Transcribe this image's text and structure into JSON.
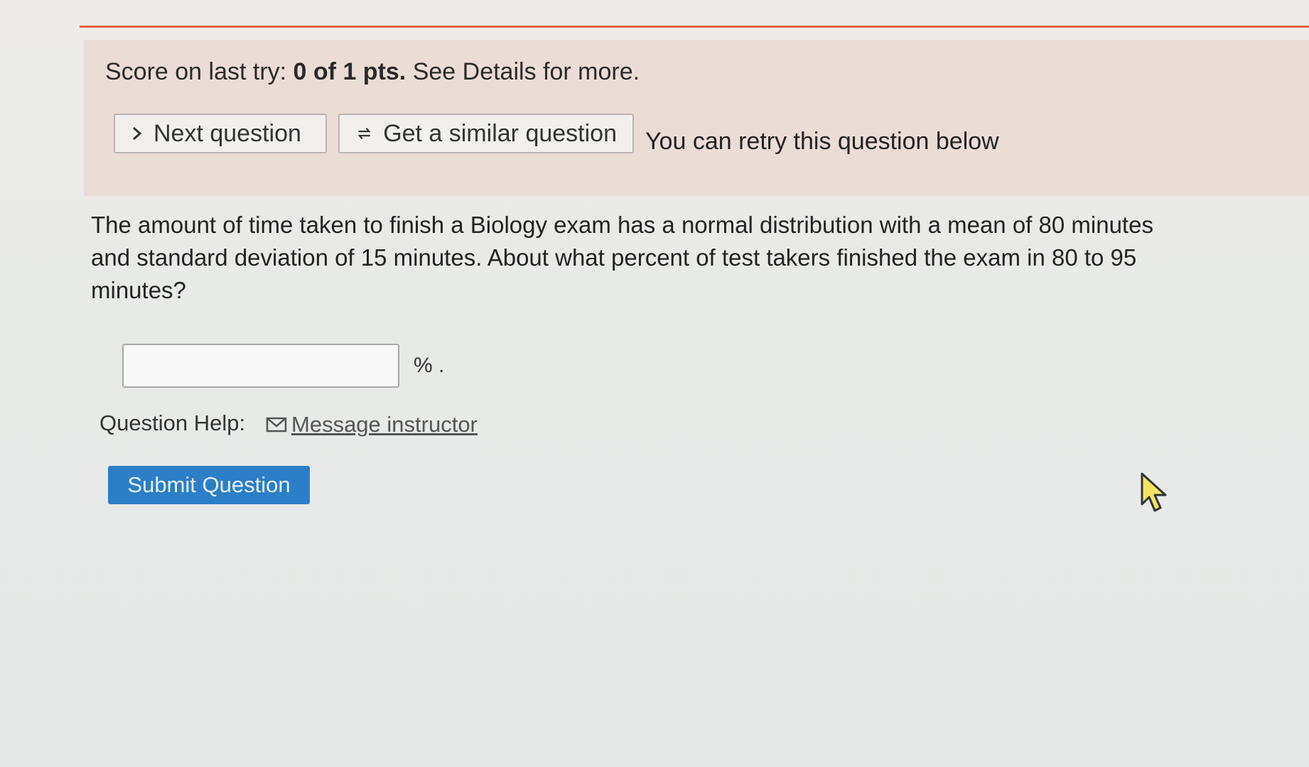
{
  "status": {
    "score_prefix": "Score on last try: ",
    "score_value": "0 of 1 pts.",
    "score_suffix": " See Details for more."
  },
  "actions": {
    "next_label": "Next question",
    "similar_label": "Get a similar question",
    "retry_note": "You can retry this question below"
  },
  "question": {
    "text": "The amount of time taken to finish a Biology exam has a normal distribution with a mean of 80 minutes and standard deviation of 15 minutes. About what percent of test takers finished the exam in 80 to 95 minutes?"
  },
  "answer": {
    "value": "",
    "unit": "% ."
  },
  "help": {
    "label": "Question Help:",
    "link_label": "Message instructor"
  },
  "submit": {
    "label": "Submit Question"
  },
  "colors": {
    "accent_rule": "#e0643c",
    "submit_bg": "#2c7ec7"
  },
  "icons": {
    "next": "chevron-right-icon",
    "similar": "cycle-icon",
    "message": "mail-icon",
    "cursor": "mouse-pointer-icon"
  }
}
